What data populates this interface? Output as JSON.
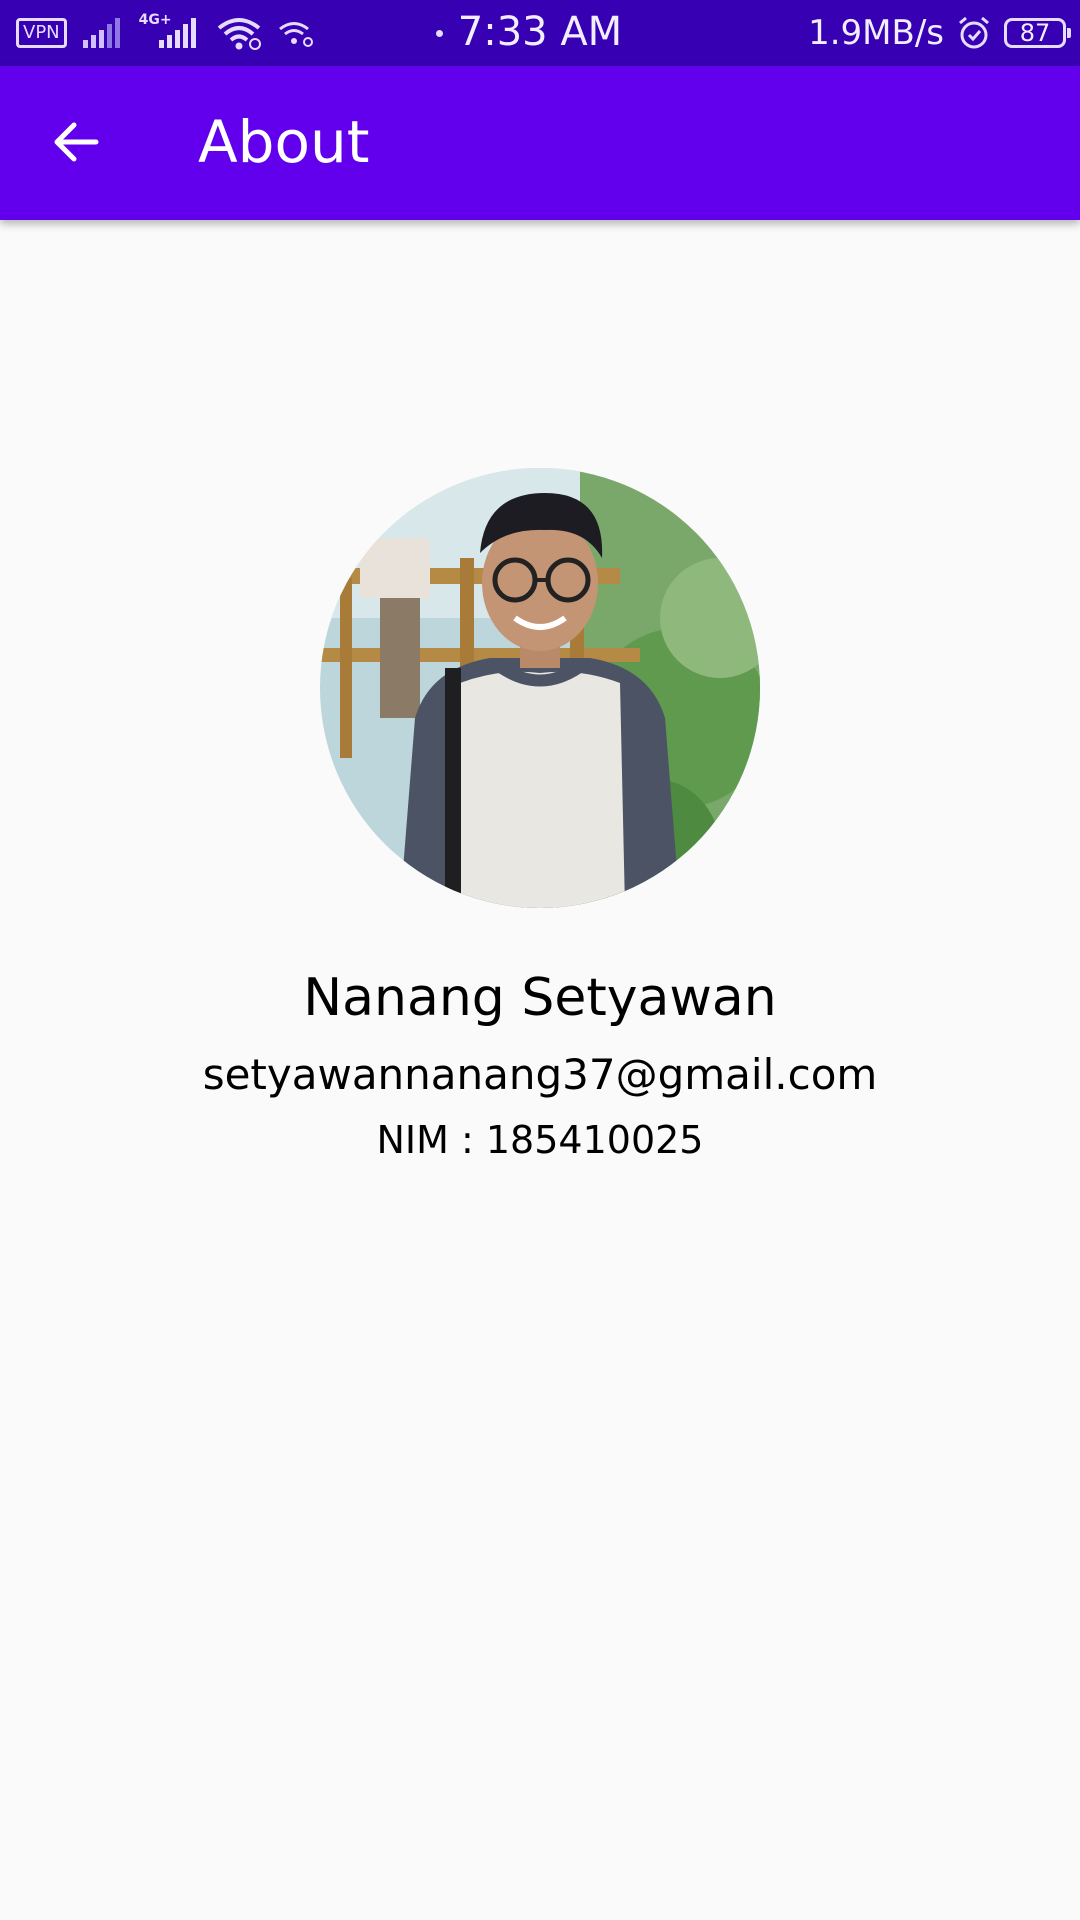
{
  "status_bar": {
    "vpn": "VPN",
    "network": "4G+",
    "time": "7:33 AM",
    "net_speed": "1.9MB/s",
    "battery": "87",
    "icons": [
      "signal-icon",
      "mobile-signal-icon",
      "wifi-icon",
      "hotspot-icon",
      "alarm-icon",
      "battery-icon"
    ]
  },
  "app_bar": {
    "title": "About",
    "back_icon": "arrow-left-icon",
    "color": "#6200ee"
  },
  "profile": {
    "name": "Nanang Setyawan",
    "email": "setyawannanang37@gmail.com",
    "nim": "NIM : 185410025"
  },
  "colors": {
    "status_bar": "#3700b3",
    "app_bar": "#6200ee",
    "background": "#fafafa"
  }
}
